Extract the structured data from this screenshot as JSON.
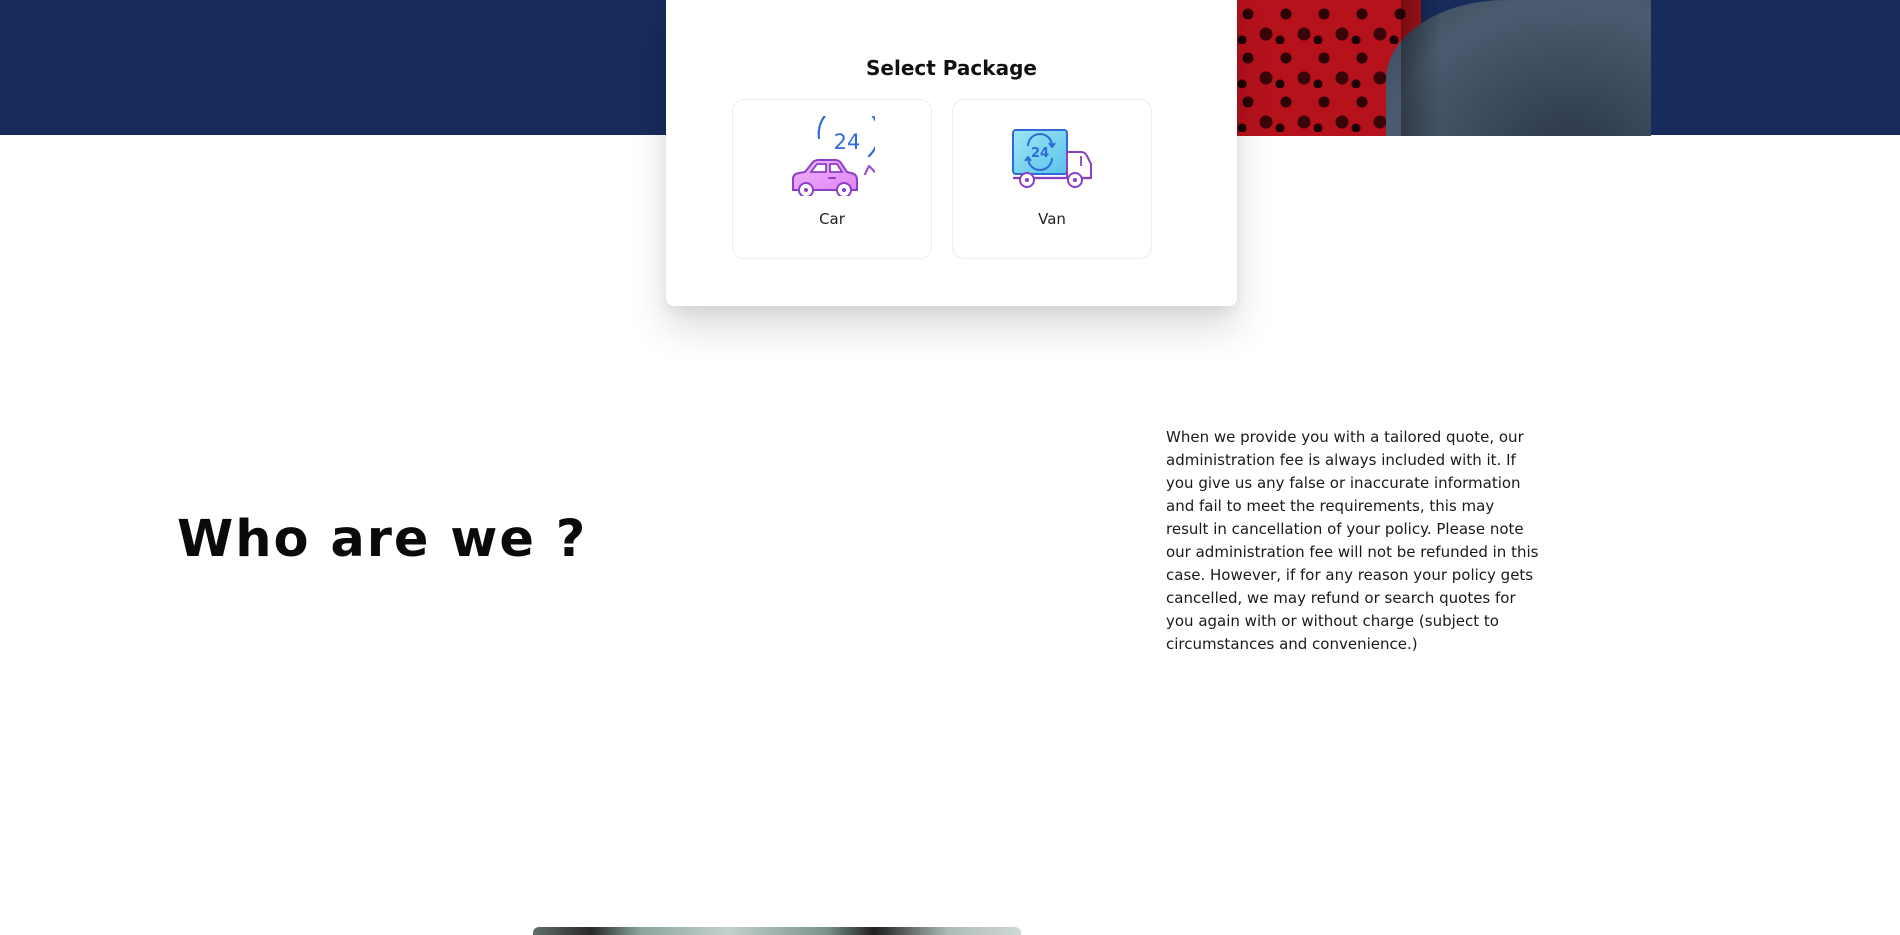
{
  "package_selector": {
    "title": "Select Package",
    "options": [
      {
        "label": "Car",
        "icon": "car-24-icon"
      },
      {
        "label": "Van",
        "icon": "van-24-icon"
      }
    ]
  },
  "about": {
    "heading": "Who are we ?",
    "body": "When we provide you with a tailored quote, our administration fee is always included with it. If you give us any false or inaccurate information and fail to meet the requirements, this may result in cancellation of your policy. Please note our administration fee will not be refunded in this case. However, if for any reason your policy gets cancelled, we may refund or search quotes for you again with or without charge (subject to circumstances and convenience.)"
  },
  "colors": {
    "hero_band": "#172c5c",
    "icon_purple": "#9b4fd6",
    "icon_blue": "#2f6bd8",
    "icon_cyan": "#6fd3ee"
  }
}
